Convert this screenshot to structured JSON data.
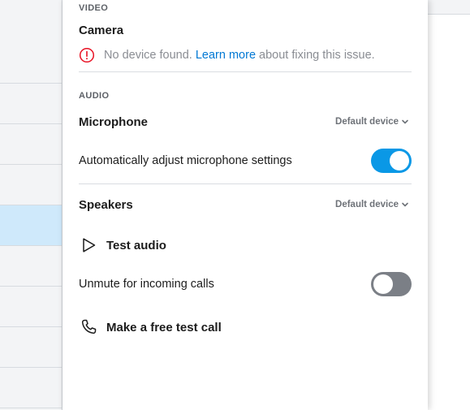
{
  "video": {
    "section_label": "VIDEO",
    "camera_title": "Camera",
    "notice_text": "No device found.",
    "notice_link": "Learn more",
    "notice_suffix": "about fixing this issue."
  },
  "audio": {
    "section_label": "AUDIO",
    "microphone": {
      "title": "Microphone",
      "device": "Default device"
    },
    "auto_adjust": {
      "label": "Automatically adjust microphone settings",
      "enabled": true
    },
    "speakers": {
      "title": "Speakers",
      "device": "Default device"
    },
    "test_audio_label": "Test audio",
    "unmute_incoming": {
      "label": "Unmute for incoming calls",
      "enabled": false
    },
    "test_call_label": "Make a free test call"
  },
  "colors": {
    "accent": "#0078d4",
    "toggle_on": "#0a98e6",
    "toggle_off": "#7b7f86",
    "error": "#e81123",
    "selected_row": "#cfe9fb"
  }
}
